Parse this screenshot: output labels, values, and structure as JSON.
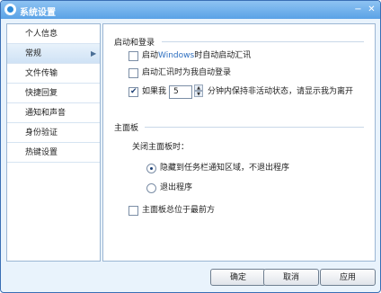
{
  "window": {
    "title": "系统设置",
    "minimize_glyph": "−",
    "close_glyph": "✕"
  },
  "sidebar": {
    "items": [
      {
        "label": "个人信息"
      },
      {
        "label": "常规",
        "active": true,
        "arrow": "▶"
      },
      {
        "label": "文件传输"
      },
      {
        "label": "快捷回复"
      },
      {
        "label": "通知和声音"
      },
      {
        "label": "身份验证"
      },
      {
        "label": "热键设置"
      }
    ]
  },
  "startup": {
    "title": "启动和登录",
    "auto_start": {
      "label_prefix": "启动",
      "label_highlight": "Windows",
      "label_suffix": "时自动启动汇讯",
      "checked": false
    },
    "auto_login": {
      "label": "启动汇讯时为我自动登录",
      "checked": false
    },
    "idle": {
      "label_prefix": "如果我",
      "minutes": "5",
      "label_suffix": "分钟内保持非活动状态，请显示我为离开",
      "checked": true
    }
  },
  "main_panel": {
    "title": "主面板",
    "on_close_label": "关闭主面板时：",
    "radio_hide": {
      "label": "隐藏到任务栏通知区域，不退出程序",
      "checked": true
    },
    "radio_exit": {
      "label": "退出程序",
      "checked": false
    },
    "always_on_top": {
      "label": "主面板总位于最前方",
      "checked": false
    }
  },
  "buttons": {
    "ok": "确定",
    "cancel": "取消",
    "apply": "应用"
  },
  "colors": {
    "titlebar": "#5aa2e6",
    "window_bg": "#e9f3fc",
    "highlight_text": "#2d6fc0"
  }
}
